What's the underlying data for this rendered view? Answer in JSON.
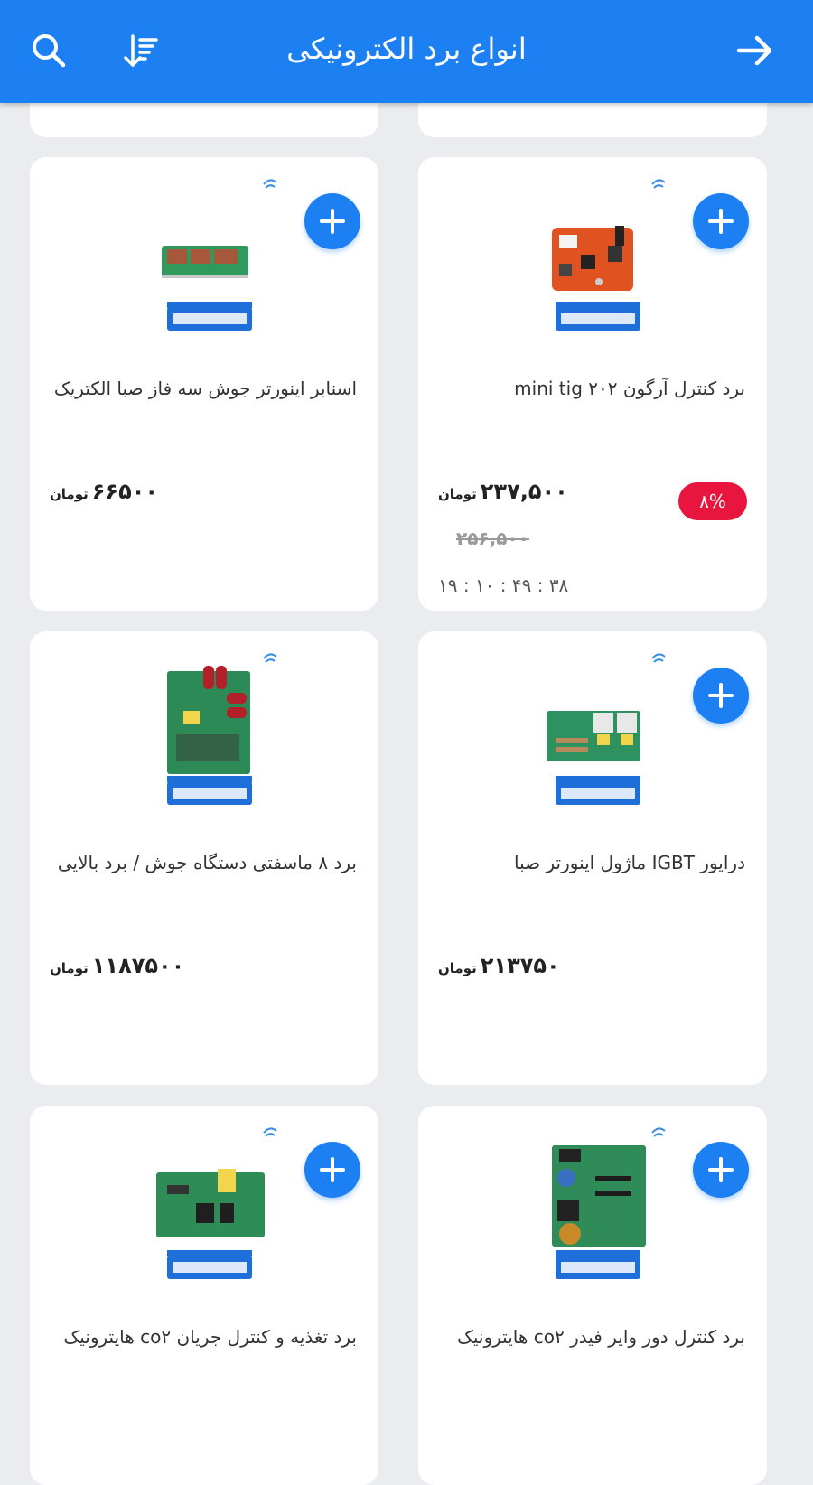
{
  "header": {
    "title": "انواع برد الکترونیکی",
    "back_icon": "arrow-right-icon",
    "sort_icon": "sort-icon",
    "search_icon": "search-icon"
  },
  "colors": {
    "primary": "#1c7ff2",
    "discount": "#e8163f",
    "background": "#ebecef"
  },
  "products": [
    {
      "name": "برد کنترل آرگون ۲۰۲ mini tig",
      "price": "۲۳۷,۵۰۰",
      "currency": "تومان",
      "old_price": "۲۵۶,۵۰۰",
      "discount": "۸%",
      "timer": "۱۹ : ۱۰ : ۴۹ : ۳۸",
      "has_add_button": true
    },
    {
      "name": "اسنابر اینورتر جوش سه فاز صبا الکتریک",
      "price": "۶۶۵۰۰",
      "currency": "تومان",
      "has_add_button": true
    },
    {
      "name": "درایور IGBT ماژول اینورتر صبا",
      "price": "۲۱۳۷۵۰",
      "currency": "تومان",
      "has_add_button": true
    },
    {
      "name": "برد ۸ ماسفتی دستگاه جوش / برد بالایی",
      "price": "۱۱۸۷۵۰۰",
      "currency": "تومان",
      "has_add_button": false
    },
    {
      "name": "برد کنترل دور وایر فیدر co۲ هایترونیک",
      "has_add_button": true
    },
    {
      "name": "برد تغذیه و کنترل جریان co۲ هایترونیک",
      "has_add_button": true
    }
  ]
}
